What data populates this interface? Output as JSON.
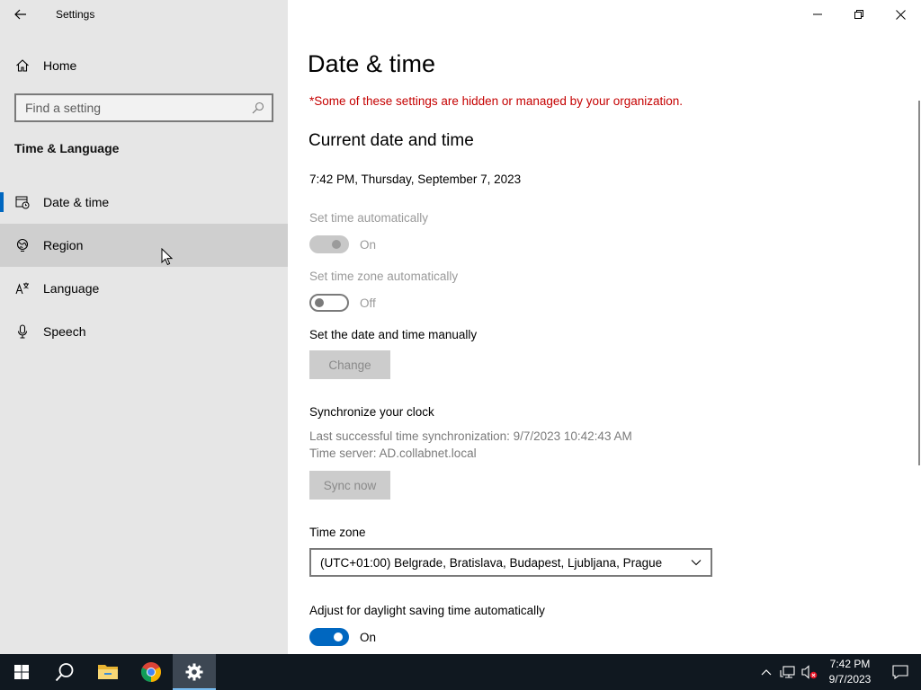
{
  "window": {
    "title": "Settings"
  },
  "sidebar": {
    "home_label": "Home",
    "search_placeholder": "Find a setting",
    "section_heading": "Time & Language",
    "items": [
      {
        "label": "Date & time",
        "icon": "date-time-icon",
        "selected": true
      },
      {
        "label": "Region",
        "icon": "region-globe-icon",
        "hovered": true
      },
      {
        "label": "Language",
        "icon": "language-icon"
      },
      {
        "label": "Speech",
        "icon": "microphone-icon"
      }
    ]
  },
  "main": {
    "title": "Date & time",
    "org_note": "*Some of these settings are hidden or managed by your organization.",
    "current_heading": "Current date and time",
    "current_datetime": "7:42 PM, Thursday, September 7, 2023",
    "set_time_auto": {
      "label": "Set time automatically",
      "state": "On"
    },
    "set_tz_auto": {
      "label": "Set time zone automatically",
      "state": "Off"
    },
    "manual": {
      "label": "Set the date and time manually",
      "button": "Change"
    },
    "sync": {
      "heading": "Synchronize your clock",
      "last_sync": "Last successful time synchronization: 9/7/2023 10:42:43 AM",
      "server": "Time server: AD.collabnet.local",
      "button": "Sync now"
    },
    "timezone": {
      "label": "Time zone",
      "value": "(UTC+01:00) Belgrade, Bratislava, Budapest, Ljubljana, Prague"
    },
    "dst": {
      "label": "Adjust for daylight saving time automatically",
      "state": "On"
    }
  },
  "taskbar": {
    "time": "7:42 PM",
    "date": "9/7/2023",
    "apps": [
      "start-icon",
      "search-icon",
      "file-explorer-icon",
      "chrome-icon",
      "settings-gear-icon"
    ]
  },
  "colors": {
    "accent": "#0067c0",
    "warning": "#c50000",
    "sidebar_bg": "#e6e6e6",
    "taskbar_bg": "#101820"
  }
}
